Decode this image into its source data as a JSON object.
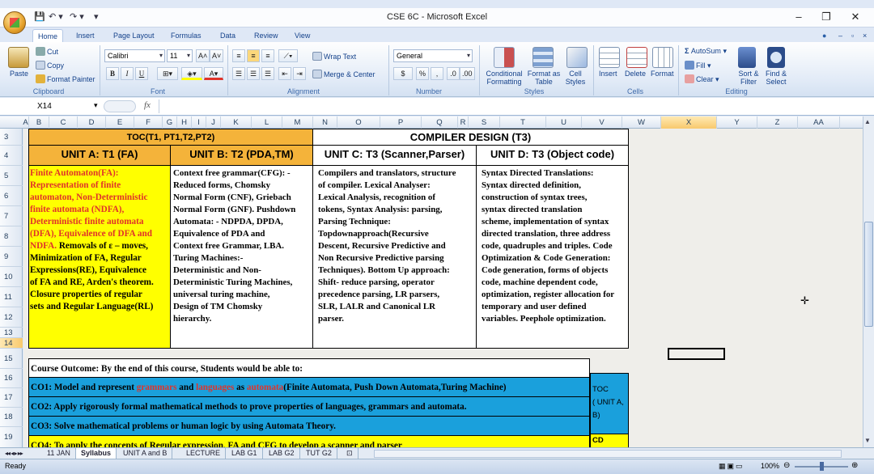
{
  "window": {
    "title": "CSE 6C  -  Microsoft Excel",
    "controls": {
      "minimize": "–",
      "restore": "❐",
      "close": "✕"
    }
  },
  "qat": {
    "save": "💾",
    "undo": "↶ ▾",
    "redo": "↷ ▾",
    "customize": "▾"
  },
  "ribbon_tabs": [
    "Home",
    "Insert",
    "Page Layout",
    "Formulas",
    "Data",
    "Review",
    "View"
  ],
  "active_tab": "Home",
  "ribbon": {
    "clipboard": {
      "paste": "Paste",
      "cut": "Cut",
      "copy": "Copy",
      "format_painter": "Format Painter",
      "label": "Clipboard"
    },
    "font": {
      "name": "Calibri",
      "size": "11",
      "grow": "A˄",
      "shrink": "A˅",
      "bold": "B",
      "italic": "I",
      "underline": "U",
      "label": "Font"
    },
    "alignment": {
      "wrap_text": "Wrap Text",
      "merge_center": "Merge & Center",
      "label": "Alignment"
    },
    "number": {
      "format": "General",
      "currency": "$",
      "percent": "%",
      "comma": ",",
      "label": "Number"
    },
    "styles": {
      "conditional": "Conditional Formatting",
      "format_table": "Format as Table",
      "cell_styles": "Cell Styles",
      "label": "Styles"
    },
    "cells": {
      "insert": "Insert",
      "delete": "Delete",
      "format": "Format",
      "label": "Cells"
    },
    "editing": {
      "autosum": "AutoSum",
      "fill": "Fill",
      "clear": "Clear",
      "sort_filter": "Sort & Filter",
      "find_select": "Find & Select",
      "label": "Editing"
    }
  },
  "formula_bar": {
    "name_box": "X14",
    "fx": "fx",
    "content": ""
  },
  "columns": [
    "A",
    "B",
    "C",
    "D",
    "E",
    "F",
    "G",
    "H",
    "I",
    "J",
    "K",
    "L",
    "M",
    "N",
    "O",
    "P",
    "Q",
    "R",
    "S",
    "T",
    "U",
    "V",
    "W",
    "X",
    "Y",
    "Z",
    "AA"
  ],
  "rows": [
    "3",
    "4",
    "5",
    "6",
    "7",
    "8",
    "9",
    "10",
    "11",
    "12",
    "13",
    "14",
    "15",
    "16",
    "17",
    "18",
    "19"
  ],
  "sheet": {
    "toc_header": "TOC(T1, PT1,T2,PT2)",
    "compiler_header": "COMPILER DESIGN (T3)",
    "units": [
      {
        "title": "UNIT A: T1 (FA)",
        "body_color": "#e0332a"
      },
      {
        "title": "UNIT B: T2  (PDA,TM)"
      },
      {
        "title": "UNIT C: T3  (Scanner,Parser)"
      },
      {
        "title": "UNIT D: T3  (Object code)"
      }
    ],
    "unit_a_lines": [
      "Finite Automaton(FA):",
      "Representation of finite",
      "automaton, Non-Deterministic",
      "finite automata (NDFA),",
      "Deterministic finite automata",
      "(DFA), Equivalence of DFA and"
    ],
    "unit_a_mixed_1": "NDFA.",
    "unit_a_mixed_2": " Removals of ε – moves,",
    "unit_a_black_lines": [
      "Minimization of FA, Regular",
      "Expressions(RE), Equivalence",
      "of FA and RE, Arden's theorem.",
      "Closure properties of regular",
      "sets and Regular Language(RL)"
    ],
    "unit_b_lines": [
      "Context free grammar(CFG): -",
      "Reduced forms, Chomsky",
      "Normal Form (CNF), Griebach",
      "Normal Form (GNF). Pushdown",
      "Automata: - NDPDA, DPDA,",
      "Equivalence of PDA and",
      "Context free Grammar, LBA.",
      "Turing Machines:-",
      "Deterministic and Non-",
      "Deterministic Turing Machines,",
      "universal turing machine,",
      "Design of TM Chomsky",
      "hierarchy."
    ],
    "unit_c_lines": [
      "Compilers and translators, structure",
      "of compiler. Lexical Analyser:",
      "Lexical Analysis, recognition of",
      "tokens, Syntax Analysis: parsing,",
      "Parsing Technique:",
      "Topdownapproach(Recursive",
      "Descent, Recursive Predictive and",
      "Non Recursive Predictive parsing",
      "Techniques). Bottom Up approach:",
      "Shift- reduce parsing, operator",
      "precedence parsing, LR parsers,",
      "SLR, LALR and Canonical LR",
      "parser."
    ],
    "unit_d_lines": [
      "Syntax Directed Translations:",
      "Syntax directed definition,",
      "construction of syntax trees,",
      "syntax directed translation",
      "scheme, implementation of syntax",
      "directed translation, three address",
      "code, quadruples and triples. Code",
      "Optimization & Code Generation:",
      "Code generation, forms of objects",
      "code, machine dependent code,",
      "optimization, register allocation for",
      "temporary and user defined",
      "variables. Peephole optimization."
    ],
    "course_outcome": "Course Outcome: By the end of this course, Students would be able to:",
    "co1": {
      "pre": "CO1: Model and represent ",
      "r1": "grammars",
      "mid1": " and ",
      "r2": "languages",
      "mid2": " as ",
      "r3": "automata",
      "post": "(Finite Automata, Push Down Automata,Turing Machine)"
    },
    "co2": "CO2: Apply rigorously formal mathematical methods to prove properties of languages, grammars and automata.",
    "co3": "CO3: Solve mathematical problems or human logic by using Automata Theory.",
    "co4": "CO4: To apply the concepts of Regular expression, FA and CFG to develop a scanner and parser",
    "side_toc": [
      "TOC",
      "( UNIT A,",
      "B)"
    ],
    "side_cd": "CD"
  },
  "sheet_tabs": [
    "11 JAN",
    "Syllabus",
    "UNIT A and B",
    "LECTURE",
    "LAB G1",
    "LAB G2",
    "TUT G2"
  ],
  "active_sheet": "Syllabus",
  "status": {
    "ready": "Ready",
    "zoom": "100%"
  },
  "colors": {
    "yellow": "#ffff00",
    "orange": "#f4b33a",
    "blue": "#1aa0dc",
    "red": "#e0332a"
  }
}
